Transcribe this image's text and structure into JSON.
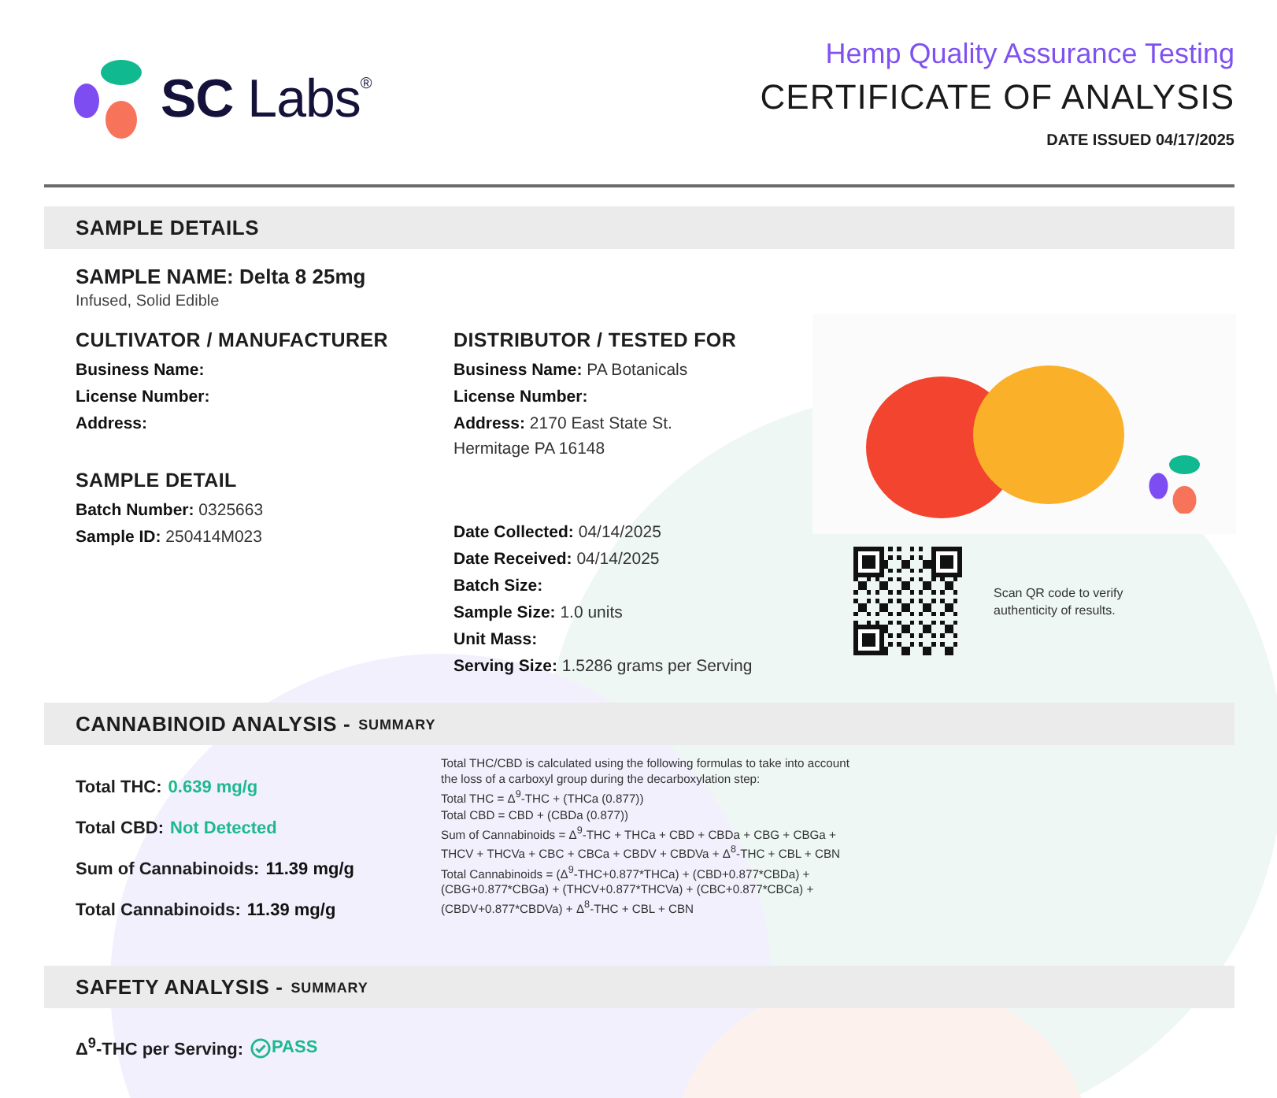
{
  "header": {
    "logo": "**SC** Labs$^{®}$",
    "tagline": "Hemp Quality Assurance Testing",
    "title": "CERTIFICATE OF ANALYSIS",
    "date_issued": "DATE ISSUED 04/17/2025"
  },
  "sample_details": {
    "heading": "SAMPLE DETAILS",
    "sample_name": "SAMPLE NAME: Delta 8 25mg",
    "sample_type": "Infused, Solid Edible",
    "cultivator": {
      "heading": "CULTIVATOR / MANUFACTURER",
      "fields": [
        {
          "label": "Business Name:"
        },
        {
          "label": "License Number:"
        },
        {
          "label": "Address:"
        }
      ]
    },
    "distributor": {
      "heading": "DISTRIBUTOR / TESTED FOR",
      "fields": [
        {
          "label": "Business Name:",
          "value": "PA Botanicals"
        },
        {
          "label": "License Number:"
        },
        {
          "label": "Address:",
          "value": "2170 East State St.",
          "continuation": "Hermitage PA 16148"
        }
      ]
    },
    "sample_detail": {
      "heading": "SAMPLE DETAIL",
      "fields": [
        {
          "label": "Batch Number:",
          "value": "0325663"
        },
        {
          "label": "Sample ID:",
          "value": "250414M023"
        }
      ]
    },
    "collection": {
      "fields": [
        {
          "label": "Date Collected:",
          "value": "04/14/2025"
        },
        {
          "label": "Date Received:",
          "value": "04/14/2025"
        },
        {
          "label": "Batch Size:"
        },
        {
          "label": "Sample Size:",
          "value": "1.0 units"
        },
        {
          "label": "Unit Mass:"
        },
        {
          "label": "Serving Size:",
          "value": "1.5286 grams per Serving"
        }
      ]
    },
    "qr_caption": "Scan QR code to verify authenticity of results."
  },
  "cannabinoid_analysis": {
    "heading": "CANNABINOID ANALYSIS -",
    "subheading": "SUMMARY",
    "results": [
      {
        "label": "Total THC:",
        "value": "0.639 mg/g",
        "highlight": true
      },
      {
        "label": "Total CBD:",
        "value": "Not Detected",
        "highlight": true
      },
      {
        "label": "Sum of Cannabinoids:",
        "value": "11.39 mg/g",
        "highlight": false
      },
      {
        "label": "Total Cannabinoids:",
        "value": "11.39 mg/g",
        "highlight": false
      }
    ],
    "formula_note": [
      "Total THC/CBD is calculated using the following formulas to take into account the loss of a carboxyl group during the decarboxylation step:",
      "Total THC = Δ$^{9}$-THC + (THCa (0.877))",
      "Total CBD = CBD + (CBDa (0.877))",
      "Sum of Cannabinoids = Δ$^{9}$-THC + THCa + CBD + CBDa + CBG + CBGa + THCV + THCVa + CBC + CBCa + CBDV + CBDVa + Δ$^{8}$-THC + CBL + CBN",
      "Total Cannabinoids = (Δ$^{9}$-THC+0.877*THCa) + (CBD+0.877*CBDa) + (CBG+0.877*CBGa) + (THCV+0.877*THCVa) + (CBC+0.877*CBCa) + (CBDV+0.877*CBDVa) + Δ$^{8}$-THC + CBL + CBN"
    ]
  },
  "safety_analysis": {
    "heading": "SAFETY ANALYSIS -",
    "subheading": "SUMMARY",
    "results": [
      {
        "label": "Δ$^{9}$-THC per Serving:",
        "status": "PASS",
        "passed": true
      }
    ]
  }
}
